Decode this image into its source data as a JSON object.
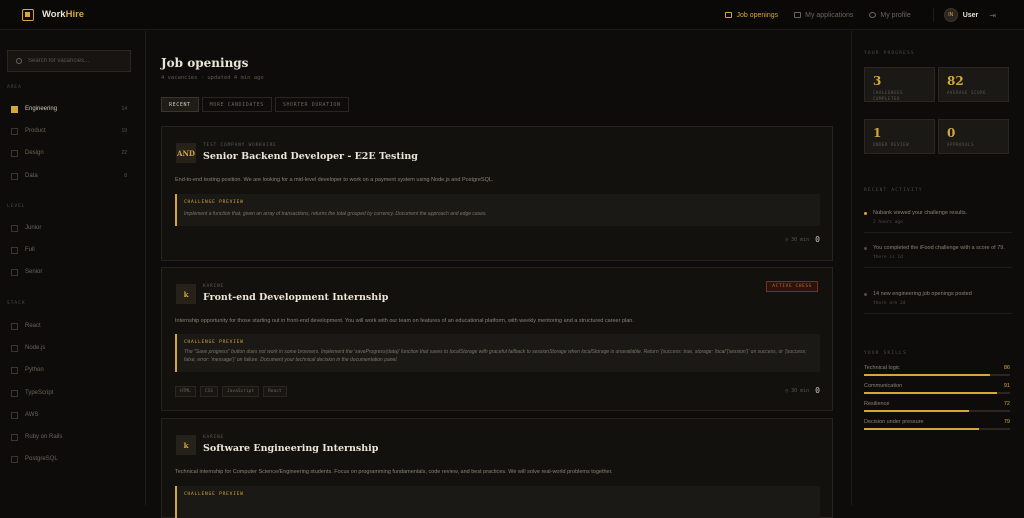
{
  "brand": {
    "name": "Work",
    "accent": "Hire"
  },
  "nav": {
    "jobs": "Job openings",
    "applications": "My applications",
    "profile": "My profile",
    "user_initials": "IN",
    "user_name": "User"
  },
  "sidebar": {
    "search_placeholder": "Search for vacancies...",
    "area_label": "AREA",
    "areas": [
      {
        "label": "Engineering",
        "count": "14",
        "checked": true
      },
      {
        "label": "Product",
        "count": "19",
        "checked": false
      },
      {
        "label": "Design",
        "count": "22",
        "checked": false
      },
      {
        "label": "Data",
        "count": "8",
        "checked": false
      }
    ],
    "level_label": "LEVEL",
    "levels": [
      "Junior",
      "Full",
      "Senior"
    ],
    "stack_label": "STACK",
    "stacks": [
      "React",
      "Node.js",
      "Python",
      "TypeScript",
      "AWS",
      "Ruby on Rails",
      "PostgreSQL"
    ]
  },
  "main": {
    "title": "Job openings",
    "subtitle": "4 vacancies · updated 4 min ago",
    "tabs": [
      "RECENT",
      "MORE CANDIDATES",
      "SHORTER DURATION"
    ]
  },
  "jobs": [
    {
      "logo": "AND",
      "company": "TEST COMPANY WORKHIRE",
      "title": "Senior Backend Developer - E2E Testing",
      "desc": "End-to-end testing position. We are looking for a mid-level developer to work on a payment system using Node.js and PostgreSQL.",
      "preview_label": "CHALLENGE PREVIEW",
      "preview": "Implement a function that, given an array of transactions, returns the total grouped by currency. Document the approach and edge cases.",
      "time": "30 min",
      "count": "0"
    },
    {
      "logo": "k",
      "company": "KARINE",
      "title": "Front-end Development Internship",
      "badge": "ACTIVE CHESS",
      "desc": "Internship opportunity for those starting out in front-end development. You will work with our team on features of an educational platform, with weekly mentoring and a structured career plan.",
      "preview_label": "CHALLENGE PREVIEW",
      "preview": "The \"Save progress\" button does not work in some browsers. Implement the 'saveProgress(data)' function that saves to localStorage with graceful fallback to sessionStorage when localStorage is unavailable. Return '{success: true, storage: 'local'|'session'}' on success, or '{success: false, error: 'message'}' on failure. Document your technical decision in the documentation panel.",
      "tags": [
        "HTML",
        "CSS",
        "JavaScript",
        "React"
      ],
      "time": "30 min",
      "count": "0"
    },
    {
      "logo": "k",
      "company": "KARINE",
      "title": "Software Engineering Internship",
      "desc": "Technical internship for Computer Science/Engineering students. Focus on programming fundamentals, code review, and best practices. We will solve real-world problems together.",
      "preview_label": "CHALLENGE PREVIEW"
    }
  ],
  "right": {
    "progress_label": "YOUR PROGRESS",
    "stats": [
      {
        "value": "3",
        "label": "CHALLENGES COMPLETED"
      },
      {
        "value": "82",
        "label": "AVERAGE SCORE"
      },
      {
        "value": "1",
        "label": "UNDER REVIEW"
      },
      {
        "value": "0",
        "label": "APPROVALS"
      }
    ],
    "activity_label": "RECENT ACTIVITY",
    "activity": [
      {
        "text": "Nubank viewed your challenge results.",
        "time": "2 hours ago",
        "hot": true
      },
      {
        "text": "You completed the iFood challenge with a score of 79.",
        "time": "there is 1d",
        "hot": false
      },
      {
        "text": "14 new engineering job openings posted",
        "time": "there are 2d",
        "hot": false
      }
    ],
    "skills_label": "YOUR SKILLS",
    "skills": [
      {
        "name": "Technical logic",
        "value": 86
      },
      {
        "name": "Communication",
        "value": 91
      },
      {
        "name": "Resilience",
        "value": 72
      },
      {
        "name": "Decision under pressure",
        "value": 79
      }
    ]
  },
  "colors": {
    "accent": "#d4a73a",
    "background": "#0d0c0a",
    "card": "#12110e",
    "badge": "#d05a44"
  }
}
